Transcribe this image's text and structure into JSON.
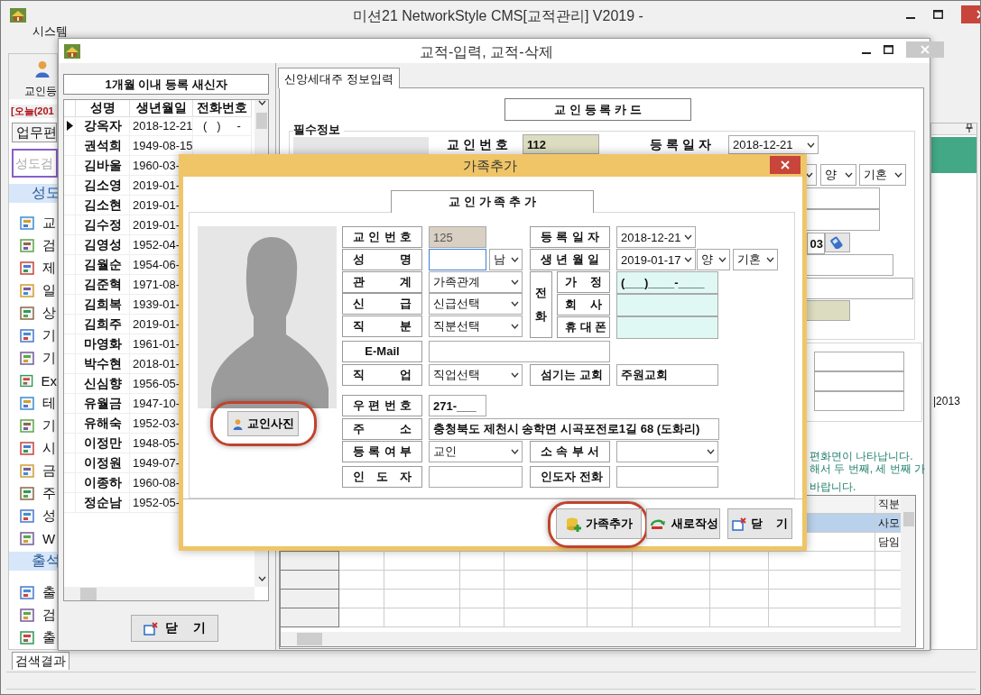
{
  "app": {
    "title": "미션21 NetworkStyle CMS[교적관리] V2019 -",
    "menu": [
      "시스템"
    ],
    "toolbar_button": "교인등",
    "today": "[오늘(201",
    "panel_tab": "업무편",
    "search": {
      "placeholder": "성도검"
    },
    "groups": [
      {
        "label": "성도",
        "items": [
          "교",
          "검",
          "제",
          "일",
          "상",
          "기",
          "기",
          "Ex",
          "테",
          "기",
          "시",
          "금",
          "주",
          "성",
          "W"
        ]
      },
      {
        "label": "출석",
        "items": [
          "출",
          "검",
          "출"
        ]
      }
    ],
    "result_tab": "검색결과",
    "side_text": "|2013"
  },
  "member_window": {
    "title": "교적-입력, 교적-삭제",
    "new_members": {
      "title": "1개월 이내 등록 새신자",
      "columns": [
        "성명",
        "생년월일",
        "전화번호"
      ],
      "rows": [
        {
          "name": "강옥자",
          "birth": "2018-12-21",
          "phone": "(   )     -",
          "selected": true
        },
        {
          "name": "권석희",
          "birth": "1949-08-15",
          "selected": false
        },
        {
          "name": "김바울",
          "birth": "1960-03-",
          "selected": false
        },
        {
          "name": "김소영",
          "birth": "2019-01-",
          "selected": false
        },
        {
          "name": "김소현",
          "birth": "2019-01-",
          "selected": false
        },
        {
          "name": "김수정",
          "birth": "2019-01-",
          "selected": false
        },
        {
          "name": "김영성",
          "birth": "1952-04-",
          "selected": false
        },
        {
          "name": "김월순",
          "birth": "1954-06-",
          "selected": false
        },
        {
          "name": "김준혁",
          "birth": "1971-08-",
          "selected": false
        },
        {
          "name": "김희복",
          "birth": "1939-01-",
          "selected": false
        },
        {
          "name": "김희주",
          "birth": "2019-01-",
          "selected": false
        },
        {
          "name": "마영화",
          "birth": "1961-01-",
          "selected": false
        },
        {
          "name": "박수현",
          "birth": "2018-01-",
          "selected": false
        },
        {
          "name": "신심향",
          "birth": "1956-05-",
          "selected": false
        },
        {
          "name": "유월금",
          "birth": "1947-10-",
          "selected": false
        },
        {
          "name": "유해숙",
          "birth": "1952-03-",
          "selected": false
        },
        {
          "name": "이정만",
          "birth": "1948-05-",
          "selected": false
        },
        {
          "name": "이정원",
          "birth": "1949-07-",
          "selected": false
        },
        {
          "name": "이종하",
          "birth": "1960-08-",
          "selected": false
        },
        {
          "name": "정순남",
          "birth": "1952-05-",
          "selected": false
        }
      ],
      "close_button": "닫 기"
    },
    "tabs": [
      {
        "label": "신앙세대주 정보입력",
        "selected": true
      }
    ],
    "card_title": "교 인 등 록 카 드",
    "section": "필수정보",
    "fields": [
      {
        "kind": "label",
        "text": "교 인 번 호"
      },
      {
        "kind": "readonly",
        "value": "112"
      },
      {
        "kind": "label",
        "text": "등 록 일 자"
      },
      {
        "kind": "select",
        "value": "2018-12-21"
      },
      {
        "kind": "select"
      },
      {
        "kind": "select",
        "value": "양"
      },
      {
        "kind": "select",
        "value": "기혼"
      },
      {
        "kind": "input"
      },
      {
        "kind": "input"
      },
      {
        "kind": "input",
        "value": "03"
      },
      {
        "kind": "phone_button"
      },
      {
        "kind": "input"
      },
      {
        "kind": "input"
      },
      {
        "kind": "readonly"
      }
    ],
    "notes": [
      "편화면이 나타납니다.",
      "해서 두 번째, 세 번째 가",
      "바랍니다."
    ],
    "table": {
      "visible_header": "직분",
      "rows": [
        {
          "selected": true,
          "cells": [
            "사모"
          ]
        },
        {
          "selected": false,
          "cells": [
            "담임"
          ]
        },
        {
          "selected": false
        },
        {
          "selected": false
        },
        {
          "selected": false
        },
        {
          "selected": false
        }
      ]
    }
  },
  "family_dialog": {
    "title": "가족추가",
    "header": "교 인 가 족 추 가",
    "photo_button": {
      "label": "교인사진",
      "highlighted": true
    },
    "fields": [
      {
        "label": "교 인 번 호",
        "kind": "readonly",
        "value": "125"
      },
      {
        "label": "성 명",
        "kind": "input",
        "focused": true,
        "suffixes": [
          {
            "kind": "select",
            "value": "남"
          }
        ]
      },
      {
        "label": "관 계",
        "kind": "select",
        "value": "가족관계"
      },
      {
        "label": "신 급",
        "kind": "select",
        "value": "신급선택"
      },
      {
        "label": "직 분",
        "kind": "select",
        "value": "직분선택"
      },
      {
        "label": "E-Mail",
        "kind": "input"
      },
      {
        "label": "직 업",
        "kind": "select",
        "value": "직업선택"
      },
      {
        "label": "우 편 번 호",
        "kind": "input",
        "value": "271-___"
      },
      {
        "label": "주 소",
        "kind": "input",
        "value": "충청북도 제천시 송학면 시곡포전로1길 68 (도화리)"
      },
      {
        "label": "등 록 여 부",
        "kind": "select",
        "value": "교인"
      },
      {
        "label": "인 도 자",
        "kind": "input"
      },
      {
        "label": "등 록 일 자",
        "kind": "select",
        "value": "2018-12-21"
      },
      {
        "label": "생 년 월 일",
        "kind": "select",
        "value": "2019-01-17",
        "suffixes": [
          {
            "kind": "select",
            "value": "양"
          },
          {
            "kind": "select",
            "value": "기혼"
          }
        ]
      },
      {
        "label": "섬기는 교회",
        "kind": "input",
        "value": "주원교회"
      },
      {
        "label": "소 속 부 서",
        "kind": "select"
      },
      {
        "label": "인도자 전화",
        "kind": "input"
      }
    ],
    "phone": {
      "label": "전화",
      "lines": [
        {
          "label": "가 정",
          "value": "(___)____-____"
        },
        {
          "label": "회 사"
        },
        {
          "label": "휴 대 폰"
        }
      ]
    },
    "buttons": [
      {
        "label": "가족추가",
        "kind": "add",
        "highlighted": true
      },
      {
        "label": "새로작성",
        "kind": "new",
        "highlighted": false
      },
      {
        "label": "닫 기",
        "kind": "close",
        "highlighted": false
      }
    ]
  }
}
